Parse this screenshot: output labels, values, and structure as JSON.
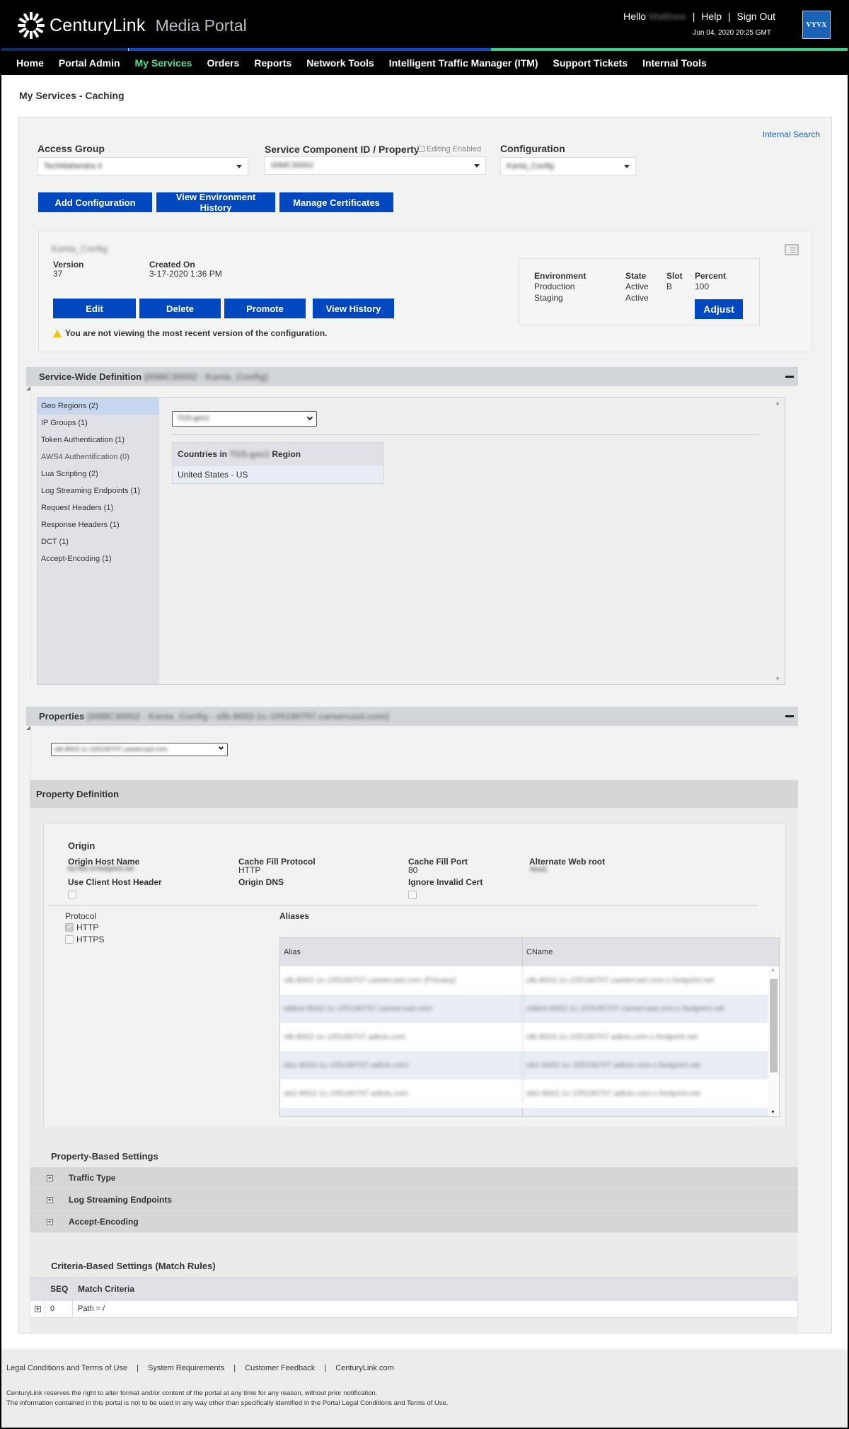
{
  "header": {
    "brand": "CenturyLink",
    "product": "Media Portal",
    "greeting": "Hello",
    "user_name": "Matthew",
    "help": "Help",
    "sign_out": "Sign Out",
    "datetime": "Jun 04, 2020 20:25 GMT",
    "partner_logo": "VYVX"
  },
  "nav": {
    "items": [
      "Home",
      "Portal Admin",
      "My Services",
      "Orders",
      "Reports",
      "Network Tools",
      "Intelligent Traffic Manager (ITM)",
      "Support Tickets",
      "Internal Tools"
    ],
    "active": "My Services"
  },
  "page": {
    "title": "My Services - Caching",
    "internal_search": "Internal Search"
  },
  "filters": {
    "access_group_label": "Access Group",
    "access_group_value": "TechMahendra 4",
    "scid_label": "Service Component ID / Property",
    "editing_enabled": "Editing Enabled",
    "scid_value": "00MC30002",
    "configuration_label": "Configuration",
    "configuration_value": "Kanta_Config"
  },
  "actions": {
    "add_configuration": "Add Configuration",
    "view_environment_history": "View Environment History",
    "manage_certificates": "Manage Certificates"
  },
  "config": {
    "name": "Kanta_Config",
    "version_label": "Version",
    "version": "37",
    "created_label": "Created On",
    "created": "3-17-2020 1:36 PM",
    "buttons": {
      "edit": "Edit",
      "delete": "Delete",
      "promote": "Promote",
      "view_history": "View History"
    },
    "warning": "You are not viewing the most recent version of the configuration.",
    "env_headers": {
      "environment": "Environment",
      "state": "State",
      "slot": "Slot",
      "percent": "Percent"
    },
    "environments": [
      {
        "environment": "Production",
        "state": "Active",
        "slot": "B",
        "percent": "100"
      },
      {
        "environment": "Staging",
        "state": "Active",
        "slot": "",
        "percent": ""
      }
    ],
    "adjust": "Adjust"
  },
  "service_wide": {
    "title": "Service-Wide Definition",
    "subtitle": "(00MC30002 - Kanta_Config)",
    "menu": [
      {
        "label": "Geo Regions (2)",
        "active": true
      },
      {
        "label": "IP Groups (1)"
      },
      {
        "label": "Token Authentication (1)"
      },
      {
        "label": "AWS4 Authentification (0)",
        "muted": true
      },
      {
        "label": "Lua Scripting (2)"
      },
      {
        "label": "Log Streaming Endpoints (1)"
      },
      {
        "label": "Request Headers (1)"
      },
      {
        "label": "Response Headers (1)"
      },
      {
        "label": "DCT (1)"
      },
      {
        "label": "Accept-Encoding (1)"
      }
    ],
    "region_select": "TGS-geo1",
    "countries_prefix": "Countries in",
    "countries_region": "TGS-geo1",
    "countries_suffix": "Region",
    "countries": [
      "United States - US"
    ]
  },
  "properties": {
    "title": "Properties",
    "subtitle": "(00MC30002 - Kanta_Config - olb-8002-1c-155190707.careercast.com)",
    "selected": "olb-8002-1c-155190707.careercast.com",
    "definition_title": "Property Definition",
    "origin": {
      "title": "Origin",
      "host_name_label": "Origin Host Name",
      "host_name": "bo7b0.vl.footprint.net",
      "use_client_host_header_label": "Use Client Host Header",
      "use_client_host_header": false,
      "cache_fill_protocol_label": "Cache Fill Protocol",
      "cache_fill_protocol": "HTTP",
      "origin_dns_label": "Origin DNS",
      "cache_fill_port_label": "Cache Fill Port",
      "cache_fill_port": "80",
      "ignore_invalid_cert_label": "Ignore Invalid Cert",
      "ignore_invalid_cert": false,
      "alternate_web_root_label": "Alternate Web root",
      "alternate_web_root": "/test2"
    },
    "protocol": {
      "label": "Protocol",
      "options": [
        {
          "label": "HTTP",
          "checked": true
        },
        {
          "label": "HTTPS",
          "checked": false
        }
      ]
    },
    "aliases": {
      "title": "Aliases",
      "headers": [
        "Alias",
        "CName"
      ],
      "rows": [
        [
          "olb-8002-1c-155190707.careercast.com (Primary)",
          "olb-8002-1c-155190707.careercast.com.c.footprint.net"
        ],
        [
          "oldest-8002-1c-155190707.careercast.com",
          "oldest-8002-1c-155190707.careercast.com.c.footprint.net"
        ],
        [
          "olb-8002-1c-155190707.adicio.com",
          "olb-8002-1c-155190707.adicio.com.c.footprint.net"
        ],
        [
          "ob1-8002-1c-155190707.adicio.com",
          "ob1-8002-1c-155190707.adicio.com.c.footprint.net"
        ],
        [
          "ob2-8002-1c-155190707.adicio.com",
          "ob2-8002-1c-155190707.adicio.com.c.footprint.net"
        ]
      ]
    },
    "property_based_title": "Property-Based Settings",
    "property_based": [
      "Traffic Type",
      "Log Streaming Endpoints",
      "Accept-Encoding"
    ],
    "criteria_title": "Criteria-Based Settings (Match Rules)",
    "criteria_headers": [
      "SEQ",
      "Match Criteria"
    ],
    "criteria_rows": [
      {
        "seq": "0",
        "criteria": "Path = /"
      }
    ]
  },
  "footer": {
    "links": [
      "Legal Conditions and Terms of Use",
      "System Requirements",
      "Customer Feedback",
      "CenturyLink.com"
    ],
    "note1": "CenturyLink reserves the right to alter format and/or content of the portal at any time for any reason, without prior notification.",
    "note2": "The information contained in this portal is not to be used in any way other than specifically identified in the Portal Legal Conditions and Terms of Use."
  }
}
